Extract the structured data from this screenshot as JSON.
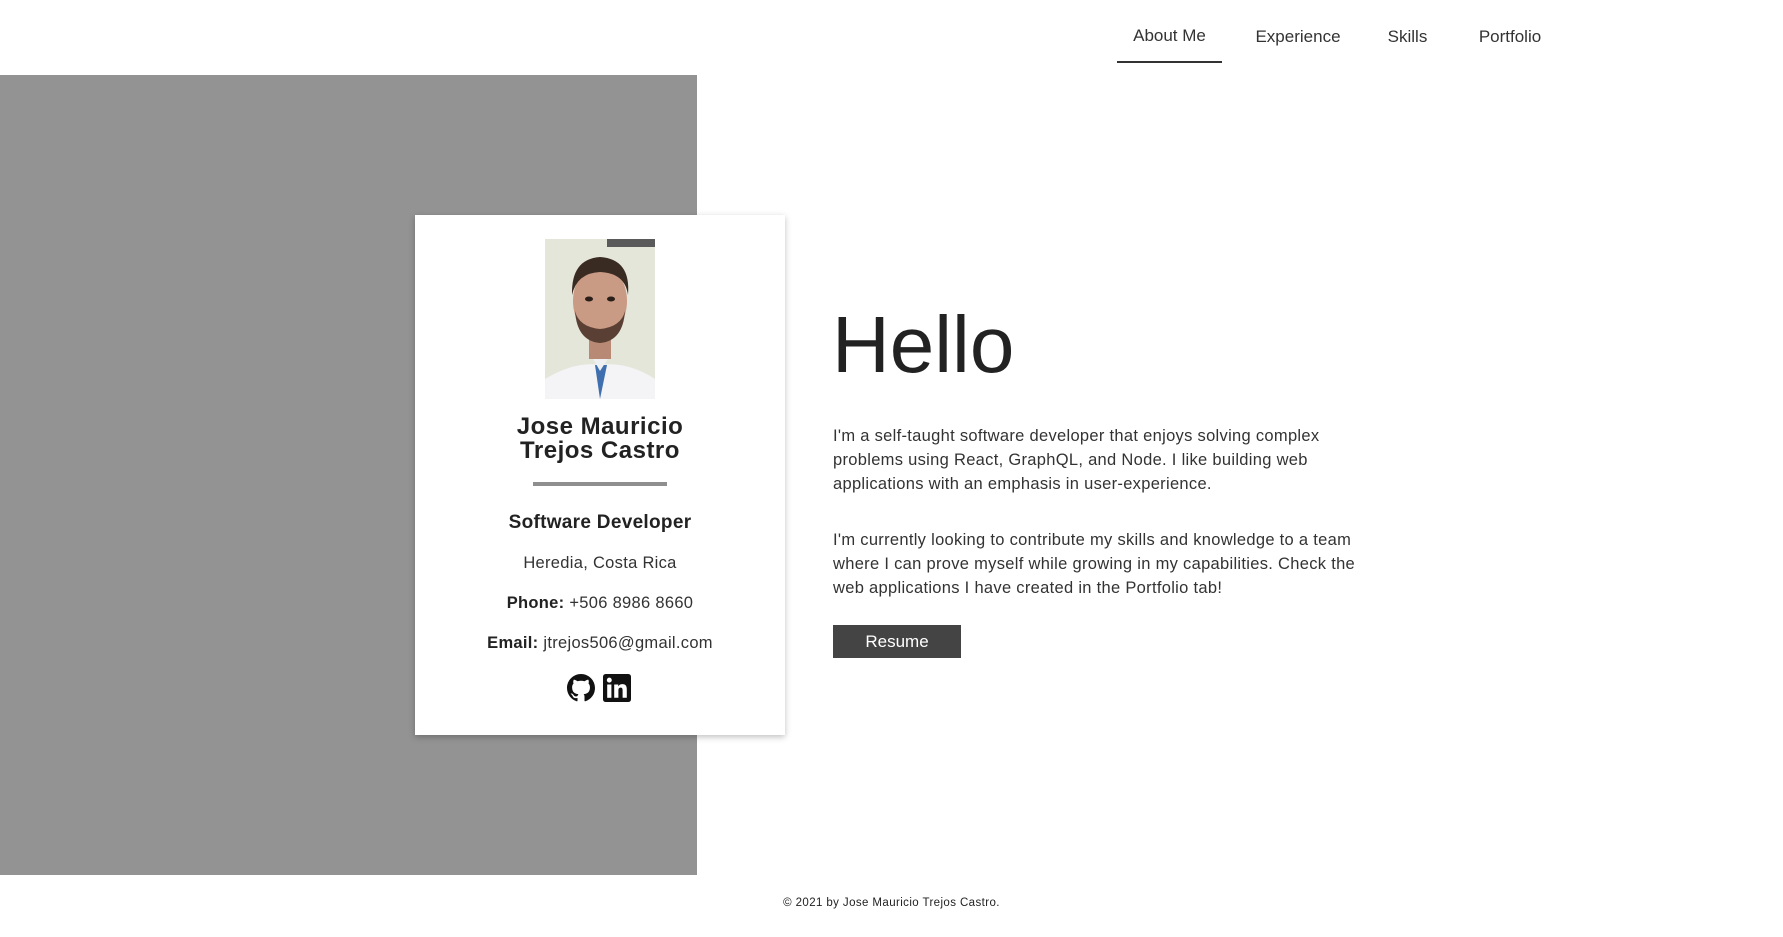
{
  "nav": {
    "items": [
      {
        "label": "About Me",
        "active": true
      },
      {
        "label": "Experience",
        "active": false
      },
      {
        "label": "Skills",
        "active": false
      },
      {
        "label": "Portfolio",
        "active": false
      }
    ]
  },
  "profile": {
    "name_line1": "Jose Mauricio",
    "name_line2": "Trejos Castro",
    "title": "Software Developer",
    "location": "Heredia, Costa Rica",
    "phone_label": "Phone:",
    "phone_value": "+506 8986 8660",
    "email_label": "Email:",
    "email_value": "jtrejos506@gmail.com",
    "social_icons": [
      "github-icon",
      "linkedin-icon"
    ]
  },
  "main": {
    "heading": "Hello",
    "paragraph1": "I'm a self-taught software developer that enjoys solving complex problems using React, GraphQL, and Node. I like building web applications with an emphasis in user-experience.",
    "paragraph2": "I'm currently looking to contribute my skills and knowledge to a team where I can prove myself while growing in my capabilities. Check the web applications I have created in the Portfolio tab!",
    "resume_label": "Resume"
  },
  "footer": {
    "text": "© 2021 by Jose Mauricio Trejos Castro."
  },
  "colors": {
    "panel": "#939393",
    "button": "#444444",
    "text": "#222222"
  }
}
